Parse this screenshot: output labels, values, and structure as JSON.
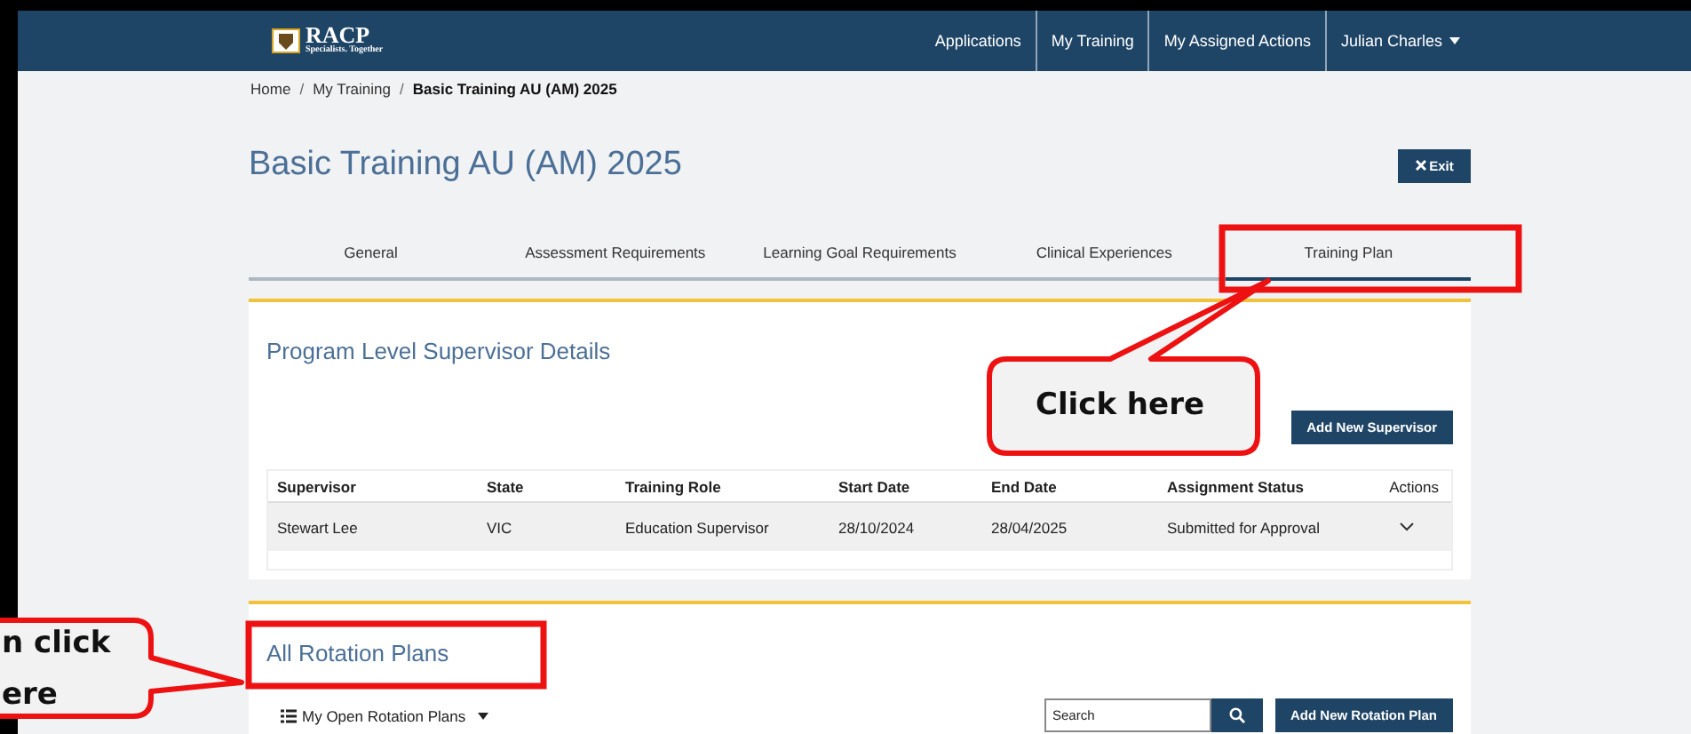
{
  "nav": {
    "logo": {
      "name": "RACP",
      "tagline": "Specialists. Together"
    },
    "links": [
      {
        "label": "Applications"
      },
      {
        "label": "My Training"
      },
      {
        "label": "My Assigned Actions"
      }
    ],
    "user": "Julian Charles"
  },
  "breadcrumb": [
    {
      "label": "Home",
      "current": false
    },
    {
      "separator": "/",
      "label": "My Training",
      "current": false
    },
    {
      "separator": "/",
      "label": "Basic Training AU (AM) 2025",
      "current": true
    }
  ],
  "title": "Basic Training AU (AM) 2025",
  "exit_button": "Exit",
  "tabs": [
    {
      "label": "General",
      "selected": false
    },
    {
      "label": "Assessment Requirements",
      "selected": false
    },
    {
      "label": "Learning Goal Requirements",
      "selected": false
    },
    {
      "label": "Clinical Experiences",
      "selected": false
    },
    {
      "label": "Training Plan",
      "selected": true
    }
  ],
  "supervisors": {
    "heading": "Program Level Supervisor Details",
    "add_button": "Add New Supervisor",
    "columns": [
      "Supervisor",
      "State",
      "Training Role",
      "Start Date",
      "End Date",
      "Assignment Status",
      "Actions"
    ],
    "rows": [
      {
        "cells": [
          "Stewart Lee",
          "VIC",
          "Education Supervisor",
          "28/10/2024",
          "28/04/2025",
          "Submitted for Approval"
        ]
      }
    ]
  },
  "rotation_plans": {
    "heading": "All Rotation Plans",
    "filter": "My Open Rotation Plans",
    "search": {
      "placeholder": "Search"
    },
    "add_button": "Add New Rotation Plan"
  },
  "annotations": [
    {
      "kind": "highlight"
    },
    {
      "kind": "callout",
      "lines": [
        "Click here"
      ]
    },
    {
      "kind": "highlight"
    },
    {
      "kind": "callout",
      "lines": [
        "n click",
        "ere"
      ]
    }
  ]
}
